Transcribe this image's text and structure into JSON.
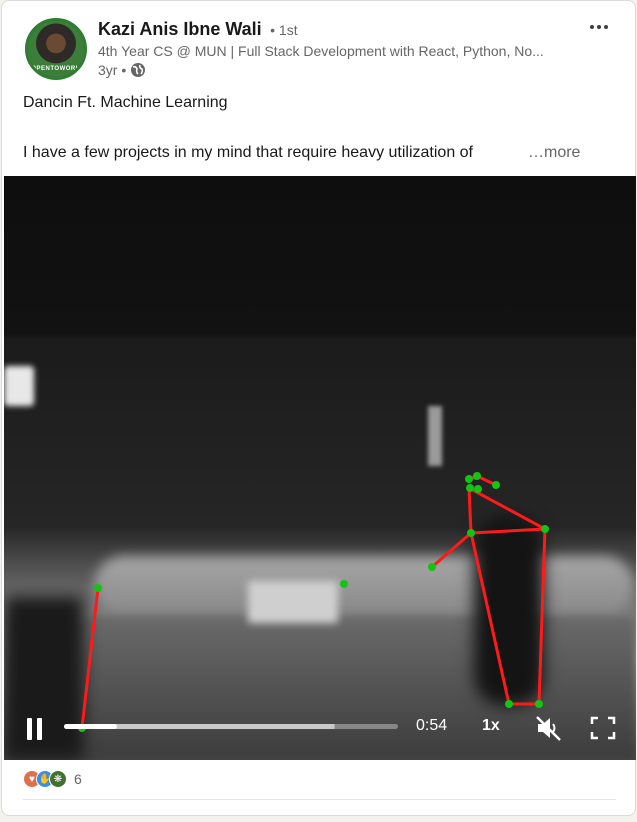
{
  "author": {
    "name": "Kazi Anis Ibne Wali",
    "connection_degree": "• 1st",
    "headline": "4th Year CS @ MUN | Full Stack Development with React, Python, No...",
    "post_age": "3yr •",
    "avatar_badge_text": "OPENTOWORK"
  },
  "post": {
    "title": "Dancin Ft. Machine Learning",
    "excerpt": "I have a few projects in my mind that require heavy utilization of",
    "see_more_label": "…more"
  },
  "video": {
    "time_label": "0:54",
    "speed_label": "1x",
    "progress_fraction": 0.16,
    "buffered_fraction": 0.81,
    "muted": true,
    "pose_colors": {
      "bone": "#ff1a1a",
      "joint": "#14c414"
    }
  },
  "social": {
    "reaction_count": "6",
    "reaction_icons": [
      "heart-icon",
      "celebrate-icon",
      "insightful-icon"
    ]
  },
  "icons": {
    "menu": "more-horizontal-icon",
    "visibility": "globe-icon",
    "play_state": "pause-icon",
    "volume": "volume-muted-icon",
    "expand": "fullscreen-icon"
  }
}
